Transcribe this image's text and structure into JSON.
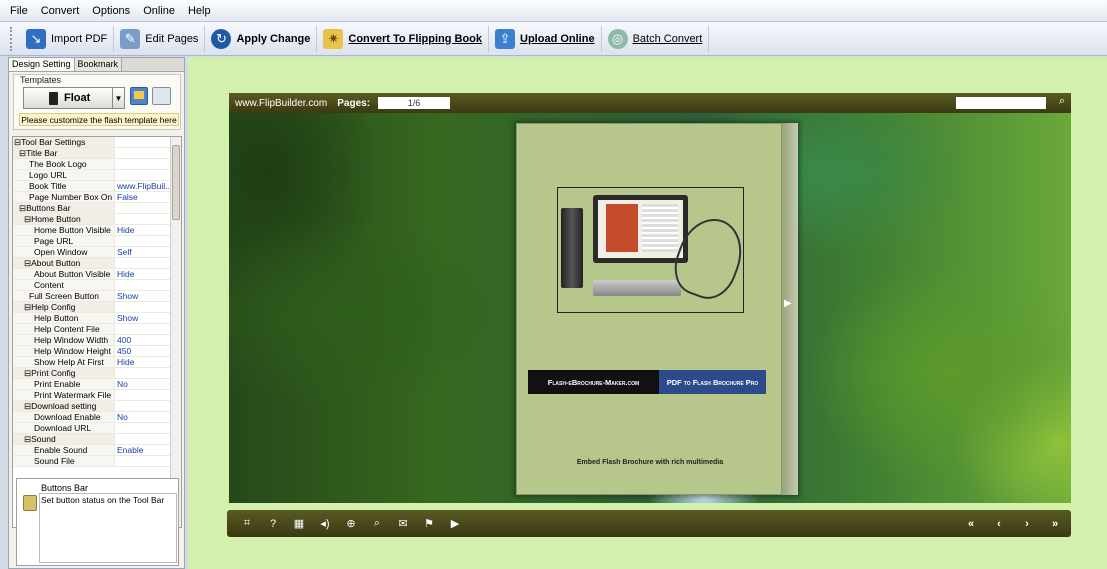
{
  "menu": [
    "File",
    "Convert",
    "Options",
    "Online",
    "Help"
  ],
  "toolbar": {
    "import_pdf": "Import PDF",
    "edit_pages": "Edit Pages",
    "apply_change": "Apply Change",
    "convert_flipping": "Convert To Flipping Book",
    "upload_online": "Upload Online",
    "batch_convert": "Batch Convert"
  },
  "left": {
    "tabs": [
      "Design Setting",
      "Bookmark"
    ],
    "templates_label": "Templates",
    "template_name": "Float",
    "customize_note": "Please customize the flash template here",
    "properties": [
      {
        "name": "⊟Tool Bar Settings",
        "value": "",
        "indent": 0
      },
      {
        "name": "⊟Title Bar",
        "value": "",
        "indent": 1
      },
      {
        "name": "The Book Logo",
        "value": "",
        "indent": 3
      },
      {
        "name": "Logo URL",
        "value": "",
        "indent": 3
      },
      {
        "name": "Book Title",
        "value": "www.FlipBuil...",
        "indent": 3
      },
      {
        "name": "Page Number Box On ...",
        "value": "False",
        "indent": 3
      },
      {
        "name": "⊟Buttons Bar",
        "value": "",
        "indent": 1
      },
      {
        "name": "⊟Home Button",
        "value": "",
        "indent": 2
      },
      {
        "name": "Home Button Visible",
        "value": "Hide",
        "indent": 4
      },
      {
        "name": "Page URL",
        "value": "",
        "indent": 4
      },
      {
        "name": "Open Window",
        "value": "Self",
        "indent": 4
      },
      {
        "name": "⊟About Button",
        "value": "",
        "indent": 2
      },
      {
        "name": "About Button Visible",
        "value": "Hide",
        "indent": 4
      },
      {
        "name": "Content",
        "value": "",
        "indent": 4
      },
      {
        "name": "Full Screen Button",
        "value": "Show",
        "indent": 3
      },
      {
        "name": "⊟Help Config",
        "value": "",
        "indent": 2
      },
      {
        "name": "Help Button",
        "value": "Show",
        "indent": 4
      },
      {
        "name": "Help Content File",
        "value": "",
        "indent": 4
      },
      {
        "name": "Help Window Width",
        "value": "400",
        "indent": 4
      },
      {
        "name": "Help Window Height",
        "value": "450",
        "indent": 4
      },
      {
        "name": "Show Help At First",
        "value": "Hide",
        "indent": 4
      },
      {
        "name": "⊟Print Config",
        "value": "",
        "indent": 2
      },
      {
        "name": "Print Enable",
        "value": "No",
        "indent": 4
      },
      {
        "name": "Print Watermark File",
        "value": "",
        "indent": 4
      },
      {
        "name": "⊟Download setting",
        "value": "",
        "indent": 2
      },
      {
        "name": "Download Enable",
        "value": "No",
        "indent": 4
      },
      {
        "name": "Download URL",
        "value": "",
        "indent": 4
      },
      {
        "name": "⊟Sound",
        "value": "",
        "indent": 2
      },
      {
        "name": "Enable Sound",
        "value": "Enable",
        "indent": 4
      },
      {
        "name": "Sound File",
        "value": "",
        "indent": 4
      }
    ],
    "help_title": "Buttons Bar",
    "help_desc": "Set button status on the Tool Bar"
  },
  "viewer": {
    "site": "www.FlipBuilder.com",
    "pages_label": "Pages:",
    "page_value": "1/6",
    "search_value": "",
    "banner_left": "Flash-eBrochure-Maker.com",
    "banner_right": "PDF to Flash Brochure Pro",
    "embed_text": "Embed Flash Brochure with rich multimedia",
    "bottom_icons": [
      "fit-icon",
      "help-icon",
      "thumbnails-icon",
      "sound-icon",
      "zoom-in-icon",
      "search-icon",
      "email-icon",
      "share-icon",
      "autoflip-icon"
    ],
    "nav_icons": [
      "first-page-icon",
      "prev-page-icon",
      "next-page-icon",
      "last-page-icon"
    ]
  },
  "colors": {
    "stage_bg": "#d3f0ad",
    "viewer_bar": "#4a4818",
    "banner_blue": "#2c4a8c"
  }
}
